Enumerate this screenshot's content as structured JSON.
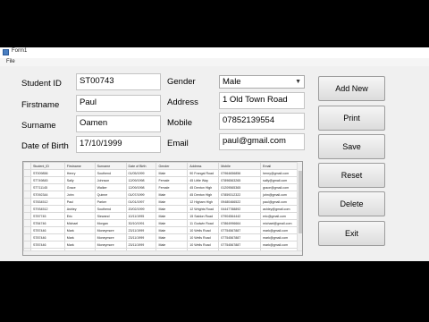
{
  "window": {
    "title": "Form1",
    "menu": [
      "File"
    ]
  },
  "form": {
    "student_id": {
      "label": "Student ID",
      "value": "ST00743"
    },
    "firstname": {
      "label": "Firstname",
      "value": "Paul"
    },
    "surname": {
      "label": "Surname",
      "value": "Oamen"
    },
    "dob": {
      "label": "Date of Birth",
      "value": "17/10/1999"
    },
    "gender": {
      "label": "Gender",
      "value": "Male"
    },
    "address": {
      "label": "Address",
      "value": "1 Old Town Road"
    },
    "mobile": {
      "label": "Mobile",
      "value": "07852139554"
    },
    "email": {
      "label": "Email",
      "value": "paul@gmail.com"
    }
  },
  "buttons": {
    "add_new": "Add New",
    "print": "Print",
    "save": "Save",
    "reset": "Reset",
    "delete": "Delete",
    "exit": "Exit"
  },
  "grid": {
    "columns": [
      "Student_ID",
      "Firstname",
      "Surname",
      "Date of Birth",
      "Gender",
      "Address",
      "Mobile",
      "Email"
    ],
    "rows": [
      [
        "ST009856",
        "Henry",
        "Southend",
        "01/05/1999",
        "Male",
        "90 Frangal Road",
        "07964656856",
        "henry@gmail.com"
      ],
      [
        "ST749845",
        "Sally",
        "Johnson",
        "12/09/1998",
        "Female",
        "45 Little Way",
        "07896563265",
        "sally@gmail.com"
      ],
      [
        "ST711145",
        "Grace",
        "Walker",
        "12/09/1998",
        "Female",
        "45 Denton High",
        "01209565365",
        "grace@gmail.com"
      ],
      [
        "ST092344",
        "John",
        "Quinne",
        "01/07/1999",
        "Male",
        "45 Denton High",
        "07859312322",
        "john@gmail.com"
      ],
      [
        "ST834512",
        "Paul",
        "Parker",
        "01/01/1997",
        "Male",
        "12 Higham High",
        "09480466522",
        "paul@gmail.com"
      ],
      [
        "ST934512",
        "Ashley",
        "Southend",
        "20/02/1999",
        "Male",
        "12 Wrights Road",
        "04447788892",
        "ashley@gmail.com"
      ],
      [
        "ST87745",
        "Eric",
        "Siewand",
        "10/11/1995",
        "Male",
        "15 Saldon Road",
        "07904564442",
        "eric@gmail.com"
      ],
      [
        "ST84746",
        "Michael",
        "Morgan",
        "30/10/1991",
        "Male",
        "11 Godwin Road",
        "07864996664",
        "michael@gmail.com"
      ],
      [
        "ST87446",
        "Mark",
        "Moneymore",
        "23/11/1999",
        "Male",
        "10 Wells Road",
        "07754567887",
        "mark@gmail.com"
      ],
      [
        "ST87446",
        "Mark",
        "Moneymore",
        "23/11/1999",
        "Male",
        "10 Wells Road",
        "07754567887",
        "mark@gmail.com"
      ],
      [
        "ST87446",
        "Mark",
        "Moneymore",
        "23/11/1999",
        "Male",
        "10 Wells Road",
        "07754567887",
        "mark@gmail.com"
      ],
      [
        "ST00743",
        "Paul",
        "Oamen",
        "17/10/1999",
        "Male",
        "1 Old Town Road",
        "07852139554",
        "paul@gmail.com"
      ],
      [
        "ST00743",
        "Paul",
        "Oamen",
        "17/10/1999",
        "Male",
        "1 Old Town Road",
        "07852139554",
        "paul@gmail.com"
      ]
    ]
  }
}
